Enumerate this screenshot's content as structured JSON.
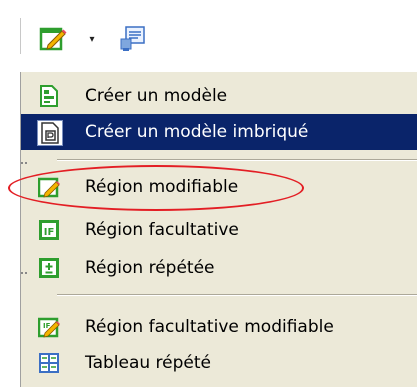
{
  "toolbar": {
    "template_button_icon": "template-icon",
    "dropdown_arrow": "▾",
    "library_button_icon": "library-icon"
  },
  "menu": {
    "items": [
      {
        "label": "Créer un modèle",
        "icon": "create-template-icon",
        "selected": false
      },
      {
        "label": "Créer un modèle imbriqué",
        "icon": "create-nested-template-icon",
        "selected": true
      },
      {
        "label": "Région modifiable",
        "icon": "editable-region-icon",
        "selected": false
      },
      {
        "label": "Région facultative",
        "icon": "optional-region-icon",
        "selected": false
      },
      {
        "label": "Région répétée",
        "icon": "repeating-region-icon",
        "selected": false
      },
      {
        "label": "Région facultative modifiable",
        "icon": "editable-optional-region-icon",
        "selected": false
      },
      {
        "label": "Tableau répété",
        "icon": "repeating-table-icon",
        "selected": false
      }
    ]
  },
  "colors": {
    "menu_background": "#ece9d8",
    "selection": "#0a246a",
    "annotation": "#e31e24",
    "icon_green": "#2e9e2e"
  }
}
